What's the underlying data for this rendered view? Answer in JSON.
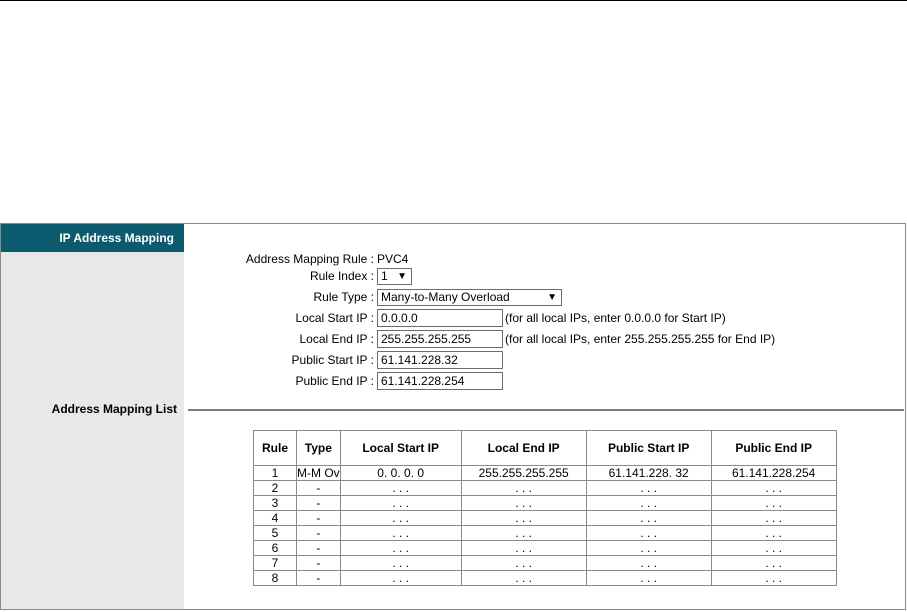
{
  "sidebar": {
    "title": "IP Address Mapping",
    "list_label": "Address Mapping List"
  },
  "form": {
    "rule_label": "Address Mapping Rule :",
    "rule_value": "PVC4",
    "rule_index_label": "Rule Index :",
    "rule_index_value": "1",
    "rule_type_label": "Rule Type :",
    "rule_type_value": "Many-to-Many Overload",
    "local_start_label": "Local Start IP :",
    "local_start_value": "0.0.0.0",
    "local_start_hint": "(for all local IPs, enter 0.0.0.0 for Start IP)",
    "local_end_label": "Local End IP :",
    "local_end_value": "255.255.255.255",
    "local_end_hint": "(for all local IPs, enter 255.255.255.255 for End IP)",
    "public_start_label": "Public Start IP :",
    "public_start_value": "61.141.228.32",
    "public_end_label": "Public End IP :",
    "public_end_value": "61.141.228.254"
  },
  "table": {
    "headers": [
      "Rule",
      "Type",
      "Local Start IP",
      "Local End IP",
      "Public Start IP",
      "Public End IP"
    ],
    "rows": [
      [
        "1",
        "M-M Ov",
        "0. 0. 0. 0",
        "255.255.255.255",
        "61.141.228. 32",
        "61.141.228.254"
      ],
      [
        "2",
        "-",
        ". . .",
        ". . .",
        ". . .",
        ". . ."
      ],
      [
        "3",
        "-",
        ". . .",
        ". . .",
        ". . .",
        ". . ."
      ],
      [
        "4",
        "-",
        ". . .",
        ". . .",
        ". . .",
        ". . ."
      ],
      [
        "5",
        "-",
        ". . .",
        ". . .",
        ". . .",
        ". . ."
      ],
      [
        "6",
        "-",
        ". . .",
        ". . .",
        ". . .",
        ". . ."
      ],
      [
        "7",
        "-",
        ". . .",
        ". . .",
        ". . .",
        ". . ."
      ],
      [
        "8",
        "-",
        ". . .",
        ". . .",
        ". . .",
        ". . ."
      ]
    ]
  },
  "icons": {
    "dropdown": "chevron-down-icon"
  },
  "colors": {
    "sidebar_header": "#0c5a6d",
    "sidebar_bg": "#e8e8e8"
  }
}
